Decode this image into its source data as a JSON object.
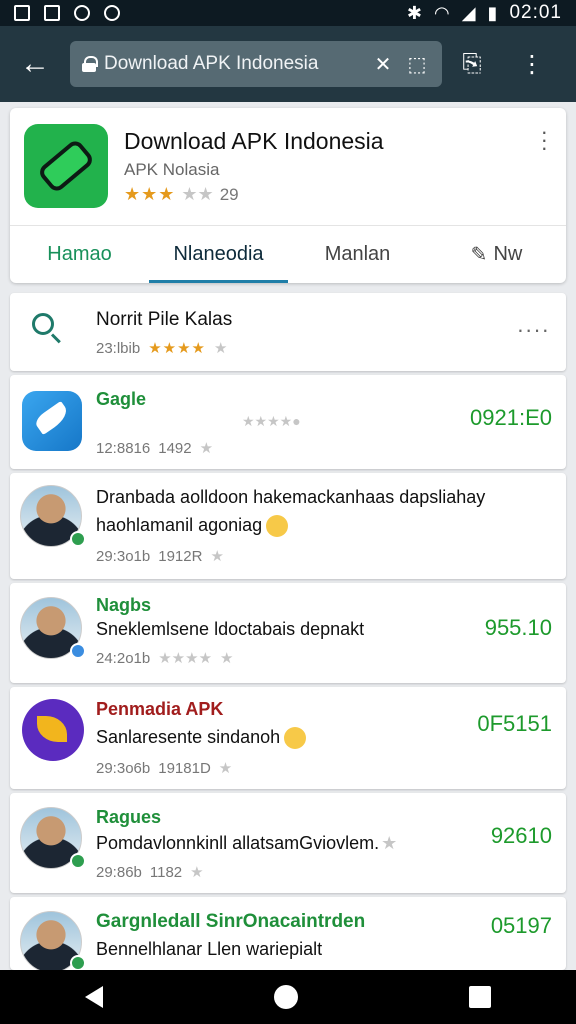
{
  "status": {
    "time": "02:01"
  },
  "browser": {
    "url": "Download APK Indonesia"
  },
  "app": {
    "title": "Download APK Indonesia",
    "subtitle": "APK Nolasia",
    "stars_filled": "★★★",
    "stars_empty": "★★",
    "rating_count": "29",
    "tabs": [
      {
        "label": "Hamao"
      },
      {
        "label": "Nlaneodia"
      },
      {
        "label": "Manlan"
      },
      {
        "label": "Nw"
      }
    ]
  },
  "search_row": {
    "title": "Norrit Pile Kalas",
    "meta": "23:lbib",
    "stars": "★★★★",
    "star_empty": "★"
  },
  "items": [
    {
      "title": "Gagle",
      "meta": "12:8816",
      "count": "1492",
      "price": "0921:E0"
    },
    {
      "body_a": "Dranbada aolldoon hakemackanhaas dapsliahay",
      "body_b": "haohlamanil agoniag",
      "meta": "29:3o1b",
      "count": "1912R"
    },
    {
      "title": "Nagbs",
      "body": "Sneklemlsene ldoctabais depnakt",
      "meta": "24:2o1b",
      "stars": "★★★★",
      "price": "955.10"
    },
    {
      "title": "Penmadia APK",
      "body": "Sanlaresente sindanoh",
      "meta": "29:3o6b",
      "count": "19181D",
      "price": "0F5151"
    },
    {
      "title": "Ragues",
      "body": "Pomdavlonnkinll allatsamGviovlem.",
      "meta": "29:86b",
      "count": "1182",
      "price": "92610"
    },
    {
      "title": "Gargnledall SinrOnacaintrden",
      "body": "Bennelhlanar Llen wariepialt",
      "price": "05197"
    }
  ]
}
